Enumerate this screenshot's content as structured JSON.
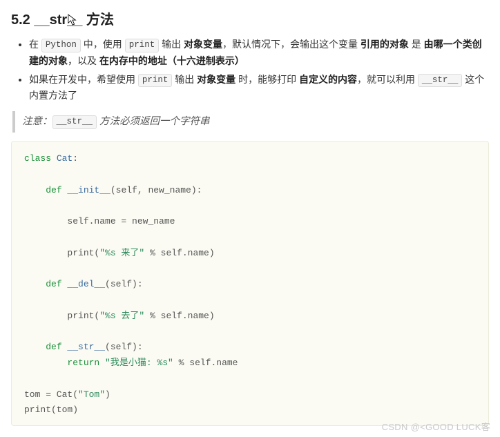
{
  "heading": {
    "num": "5.2",
    "code": "__str__",
    "tail": "方法"
  },
  "bullet1": {
    "p1": "在 ",
    "k1": "Python",
    "p2": " 中，使用 ",
    "k2": "print",
    "p3": " 输出 ",
    "b1": "对象变量",
    "p4": "，默认情况下，会输出这个变量 ",
    "b2": "引用的对象",
    "p5": " 是 ",
    "b3": "由哪一个类创建的对象",
    "p6": "，以及 ",
    "b4": "在内存中的地址（十六进制表示）"
  },
  "bullet2": {
    "p1": "如果在开发中，希望使用 ",
    "k1": "print",
    "p2": " 输出 ",
    "b1": "对象变量",
    "p3": " 时，能够打印 ",
    "b2": "自定义的内容",
    "p4": "，就可以利用 ",
    "k2": "__str__",
    "p5": " 这个内置方法了"
  },
  "note": {
    "lead": "注意：",
    "code": "__str__",
    "tail": " 方法必须返回一个字符串"
  },
  "code": {
    "l1_kw": "class",
    "l1_cls": " Cat",
    "l1_tail": ":",
    "l2_blank": "",
    "l3_indent": "    ",
    "l3_kw": "def",
    "l3_fn": " __init__",
    "l3_args": "(self, new_name):",
    "l4_blank": "",
    "l5": "        self.name = new_name",
    "l6_blank": "",
    "l7_a": "        print(",
    "l7_str": "\"%s 来了\"",
    "l7_b": " % self.name)",
    "l8_blank": "",
    "l9_indent": "    ",
    "l9_kw": "def",
    "l9_fn": " __del__",
    "l9_args": "(self):",
    "l10_blank": "",
    "l11_a": "        print(",
    "l11_str": "\"%s 去了\"",
    "l11_b": " % self.name)",
    "l12_blank": "",
    "l13_indent": "    ",
    "l13_kw": "def",
    "l13_fn": " __str__",
    "l13_args": "(self):",
    "l14_indent": "        ",
    "l14_kw": "return",
    "l14_sp": " ",
    "l14_str": "\"我是小猫: %s\"",
    "l14_tail": " % self.name",
    "l15_blank": "",
    "l16_a": "tom = Cat(",
    "l16_str": "\"Tom\"",
    "l16_b": ")",
    "l17": "print(tom)"
  },
  "watermark": "CSDN @<GOOD LUCK客"
}
